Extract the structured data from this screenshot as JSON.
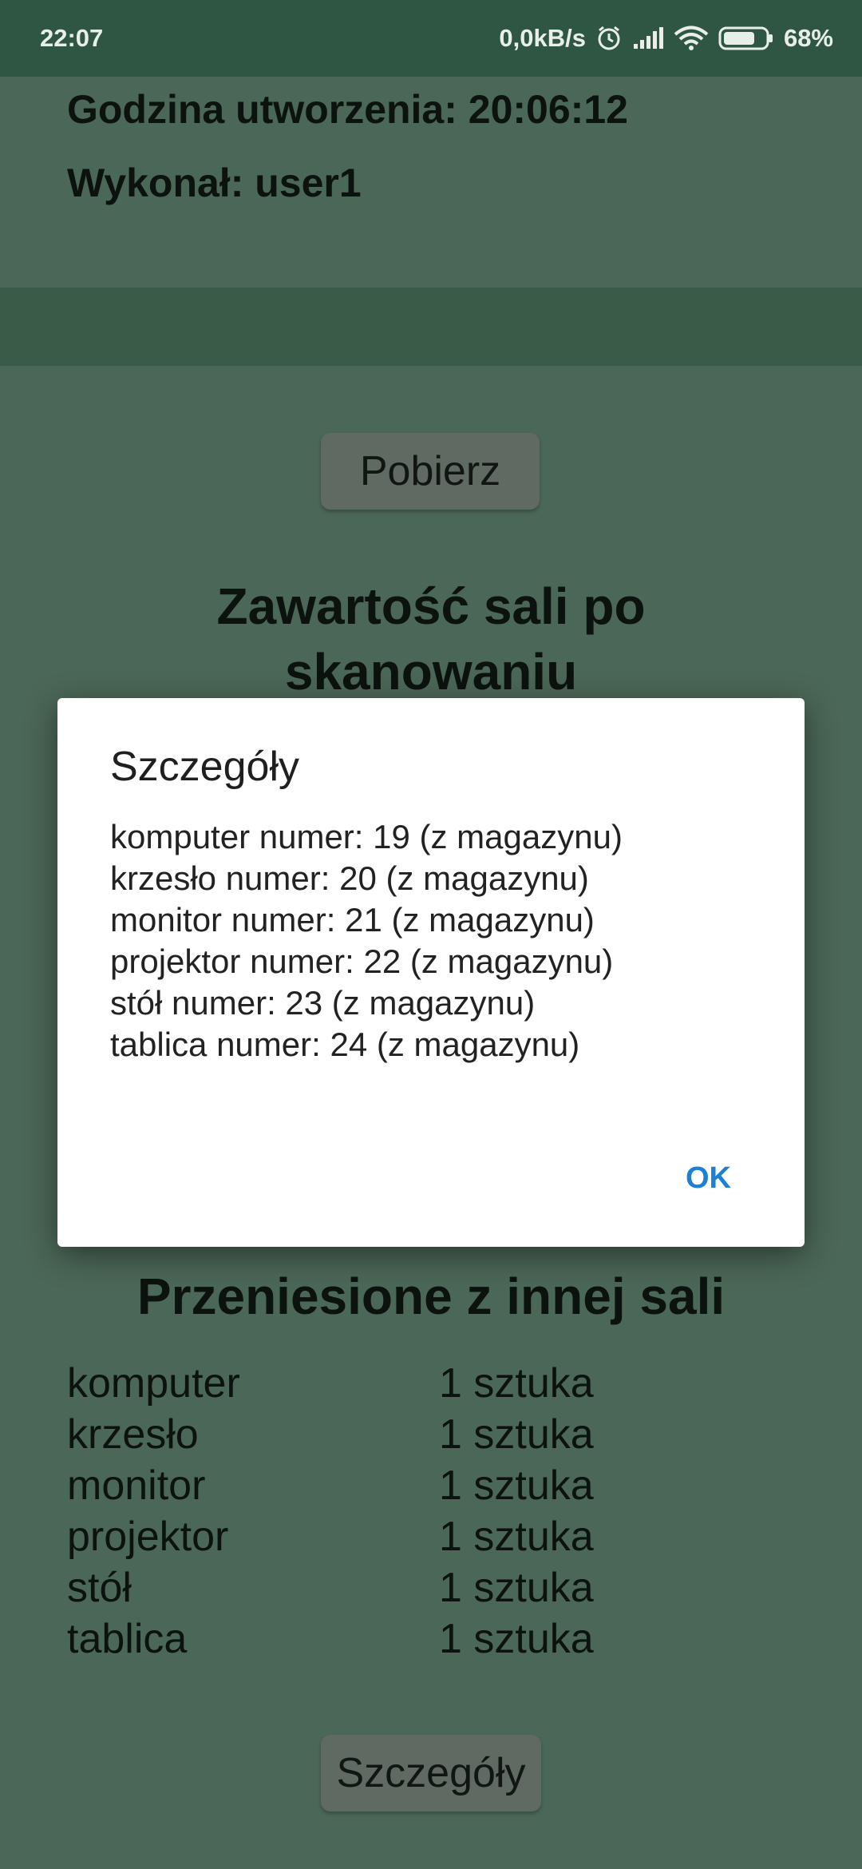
{
  "status_bar": {
    "time": "22:07",
    "speed": "0,0kB/s",
    "battery": "68%",
    "icons": [
      "alarm-icon",
      "signal-icon",
      "wifi-icon",
      "battery-icon"
    ]
  },
  "header": {
    "created_time": "Godzina utworzenia: 20:06:12",
    "performed_by": "Wykonał: user1"
  },
  "buttons": {
    "fetch": "Pobierz",
    "details": "Szczegóły"
  },
  "sections": {
    "after_scan_title": "Zawartość sali po skanowaniu",
    "moved_title": "Przeniesione z innej sali"
  },
  "moved_items": [
    {
      "name": "komputer",
      "qty": "1 sztuka"
    },
    {
      "name": "krzesło",
      "qty": "1 sztuka"
    },
    {
      "name": "monitor",
      "qty": "1 sztuka"
    },
    {
      "name": "projektor",
      "qty": "1 sztuka"
    },
    {
      "name": "stół",
      "qty": "1 sztuka"
    },
    {
      "name": "tablica",
      "qty": "1 sztuka"
    }
  ],
  "dialog": {
    "title": "Szczegóły",
    "lines": [
      "komputer numer: 19 (z magazynu)",
      "krzesło numer: 20 (z magazynu)",
      "monitor numer: 21 (z magazynu)",
      "projektor numer: 22 (z magazynu)",
      "stół numer: 23 (z magazynu)",
      "tablica numer: 24 (z magazynu)"
    ],
    "ok_label": "OK"
  },
  "colors": {
    "status_bar": "#2e5642",
    "background_dimmed": "#4b6757",
    "dialog_bg": "#ffffff",
    "accent": "#1e7fd6"
  }
}
